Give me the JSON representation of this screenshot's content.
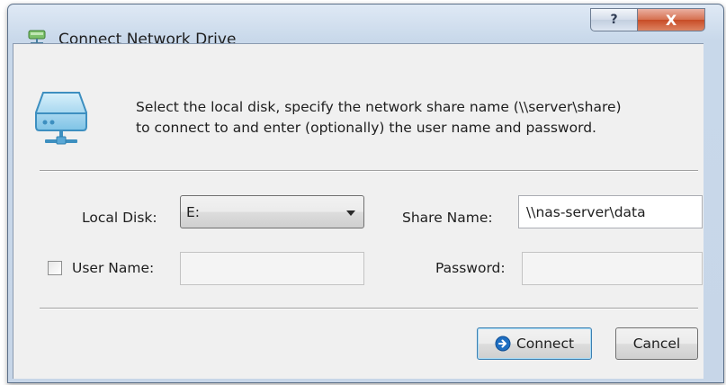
{
  "window": {
    "title": "Connect Network Drive",
    "help_glyph": "?",
    "close_glyph": "X"
  },
  "description": {
    "line1": "Select the local disk, specify the network share name (\\\\server\\share)",
    "line2": "to connect to and enter (optionally) the user name and password."
  },
  "form": {
    "local_disk_label": "Local Disk:",
    "local_disk_value": "E:",
    "share_name_label": "Share Name:",
    "share_name_value": "\\\\nas-server\\data",
    "user_name_label": "User Name:",
    "user_name_checked": false,
    "user_name_value": "",
    "password_label": "Password:",
    "password_value": ""
  },
  "buttons": {
    "connect_label": "Connect",
    "cancel_label": "Cancel"
  },
  "icons": {
    "title": "network-drive-icon",
    "banner": "disk-drive-icon",
    "connect": "arrow-circle-icon"
  },
  "colors": {
    "close_red": "#c84c26",
    "connect_blue": "#1f6fc2"
  }
}
